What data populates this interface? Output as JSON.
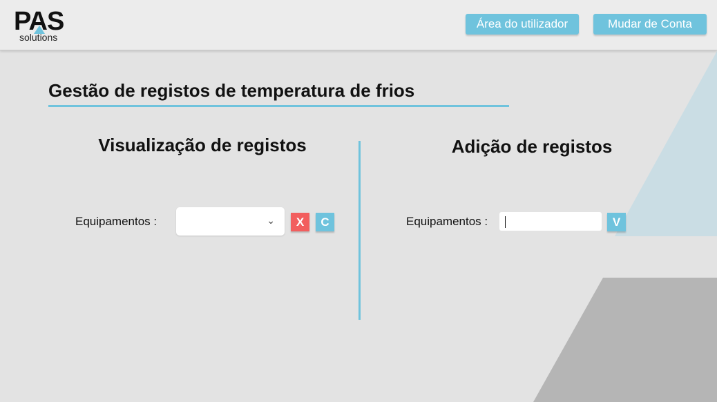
{
  "header": {
    "logo_main": "PAS",
    "logo_sub": "solutions",
    "btn_area": "Área do utilizador",
    "btn_mudar": "Mudar de Conta"
  },
  "main": {
    "title": "Gestão de registos de temperatura de frios",
    "left": {
      "heading": "Visualização de registos",
      "label": "Equipamentos :",
      "select_value": "",
      "clear_label": "X",
      "confirm_label": "C"
    },
    "right": {
      "heading": "Adição de registos",
      "label": "Equipamentos :",
      "input_value": "",
      "submit_label": "V"
    }
  },
  "colors": {
    "accent": "#6fc3dd",
    "danger": "#f25e5e",
    "background": "#e3e3e3"
  }
}
